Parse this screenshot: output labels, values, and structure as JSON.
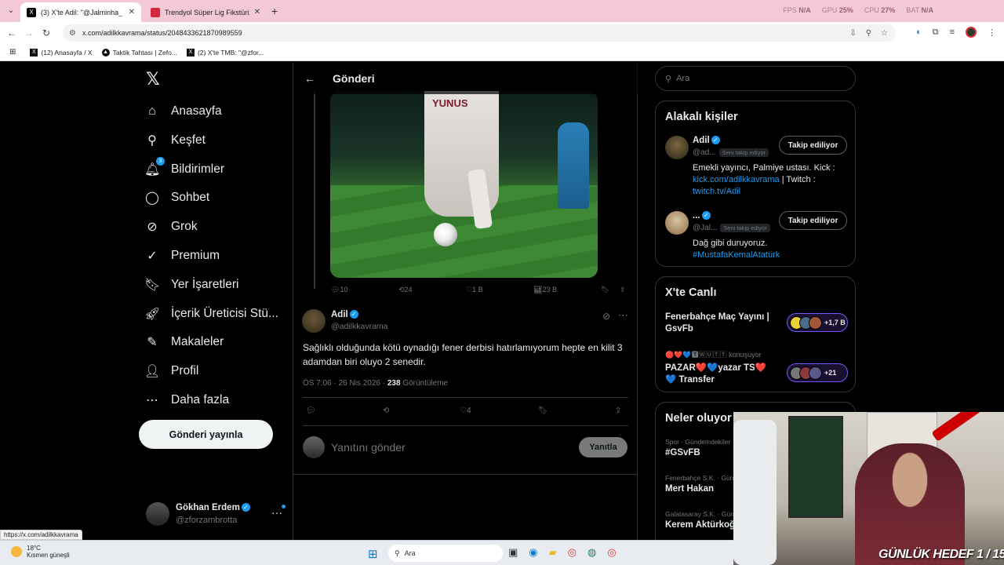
{
  "browser": {
    "tabs": [
      {
        "title": "(3) X'te Adil: \"@Jalminha_ @yu",
        "close": "✕"
      },
      {
        "title": "Trendyol Süper Lig Fikstürü ve P",
        "close": "✕"
      }
    ],
    "new_tab": "+",
    "perf": {
      "fps_label": "FPS",
      "fps": "N/A",
      "gpu_label": "GPU",
      "gpu": "25%",
      "cpu_label": "CPU",
      "cpu": "27%",
      "bat_label": "BAT",
      "bat": "N/A"
    },
    "url": "x.com/adilkkavrama/status/2048433621870989559",
    "bookmarks": [
      {
        "label": "(12) Anasayfa / X",
        "icon": "X"
      },
      {
        "label": "Taktik Tahtası | Zefo...",
        "icon": "▲"
      },
      {
        "label": "(2) X'te TMB: \"@zfor...",
        "icon": "X"
      }
    ]
  },
  "nav": {
    "logo": "𝕏",
    "items": [
      {
        "label": "Anasayfa",
        "icon": "⌂"
      },
      {
        "label": "Keşfet",
        "icon": "⚲"
      },
      {
        "label": "Bildirimler",
        "icon": "🔔︎",
        "badge": "3"
      },
      {
        "label": "Sohbet",
        "icon": "◯"
      },
      {
        "label": "Grok",
        "icon": "⊘"
      },
      {
        "label": "Premium",
        "icon": "✓"
      },
      {
        "label": "Yer İşaretleri",
        "icon": "🔖︎"
      },
      {
        "label": "İçerik Üreticisi Stü...",
        "icon": "🚀︎"
      },
      {
        "label": "Makaleler",
        "icon": "✎"
      },
      {
        "label": "Profil",
        "icon": "👤︎"
      },
      {
        "label": "Daha fazla",
        "icon": "⋯"
      }
    ],
    "post_button": "Gönderi yayınla",
    "account": {
      "name": "Gökhan Erdem",
      "handle": "@zforzambrotta",
      "more": "···"
    }
  },
  "main": {
    "back": "←",
    "title": "Gönderi",
    "media_shirt_text": "YUNUS",
    "quoted_actions": {
      "replies": "10",
      "reposts": "24",
      "likes": "1 B",
      "views": "23 B"
    },
    "tweet": {
      "name": "Adil",
      "handle": "@adilkkavrama",
      "text": "Sağlıklı olduğunda kötü oynadığı fener derbisi hatırlamıyorum hepte en kilit 3 adamdan biri oluyo 2 senedir.",
      "time": "ÖS 7:06 · 26 Nis 2026 ·",
      "views": "238",
      "views_label": "Görüntüleme",
      "likes": "4"
    },
    "reply_placeholder": "Yanıtını gönder",
    "reply_button": "Yanıtla"
  },
  "sidebar": {
    "search_placeholder": "Ara",
    "related": {
      "title": "Alakalı kişiler",
      "people": [
        {
          "name": "Adil",
          "handle": "@ad...",
          "follows_you": "Seni takip ediyor",
          "button": "Takip ediliyor",
          "bio_pre": "Emekli yayıncı, Palmiye ustası. Kick :",
          "bio_link1": "kick.com/adilkkavrama",
          "bio_mid": " | Twitch :",
          "bio_link2": "twitch.tv/Adil"
        },
        {
          "name": "...",
          "handle": "@Jal...",
          "follows_you": "Seni takip ediyor",
          "button": "Takip ediliyor",
          "bio_pre": "Dağ gibi duruyoruz.",
          "bio_link1": "#MustafaKemalAtatürk"
        }
      ]
    },
    "live": {
      "title": "X'te Canlı",
      "items": [
        {
          "title": "Fenerbahçe Maç Yayını | GsvFb",
          "count": "+1,7 B"
        },
        {
          "subtitle": "🔴❤️💙🆃🅆🅄🅃🅃 konuşuyor",
          "title": "PAZAR❤️💙yazar TS❤️💙 Transfer",
          "count": "+21"
        }
      ]
    },
    "trends": {
      "title": "Neler oluyor",
      "items": [
        {
          "context": "Spor · Gündemdekiler",
          "name": "#GSvFB"
        },
        {
          "context": "Fenerbahçe S.K. · Gün",
          "name": "Mert Hakan"
        },
        {
          "context": "Galatasaray S.K. · Gün",
          "name": "Kerem Aktürkoğ"
        }
      ]
    }
  },
  "overlay": {
    "goal_text": "GÜNLÜK HEDEF 1 / 15"
  },
  "status_url": "https://x.com/adilkkavrama",
  "taskbar": {
    "temp": "18°C",
    "weather": "Kısmen güneşli",
    "search": "Ara"
  }
}
